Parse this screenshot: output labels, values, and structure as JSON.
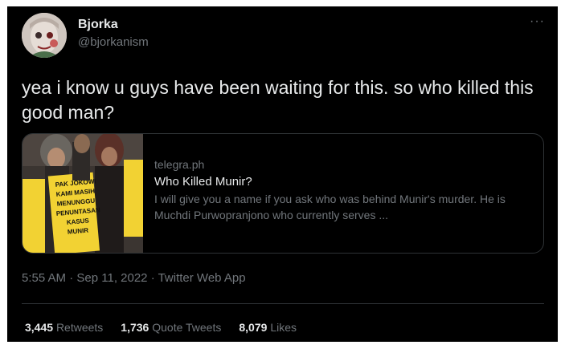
{
  "author": {
    "name": "Bjorka",
    "handle": "@bjorkanism"
  },
  "more_icon": "···",
  "tweet_text": "yea i know u guys have been waiting for this. so who killed this good man?",
  "link_card": {
    "image_desc": "protest-photo-icon",
    "domain": "telegra.ph",
    "title": "Who Killed Munir?",
    "description": "I will give you a name if you ask who was behind Munir's murder. He is Muchdi Purwopranjono who currently serves ...",
    "sign_lines": [
      "PAK JOKOWI",
      "KAMI MASIH",
      "MENUNGGU",
      "PENUNTASAN",
      "KASUS",
      "MUNIR"
    ]
  },
  "meta": {
    "time": "5:55 AM",
    "separator": " · ",
    "date": "Sep 11, 2022",
    "source": "Twitter Web App"
  },
  "stats": {
    "retweets_count": "3,445",
    "retweets_label": "Retweets",
    "quotes_count": "1,736",
    "quotes_label": "Quote Tweets",
    "likes_count": "8,079",
    "likes_label": "Likes"
  },
  "colors": {
    "background": "#000000",
    "primary_text": "#e7e9ea",
    "secondary_text": "#71767b",
    "border": "#2f3336",
    "sign_yellow": "#f2d233"
  }
}
